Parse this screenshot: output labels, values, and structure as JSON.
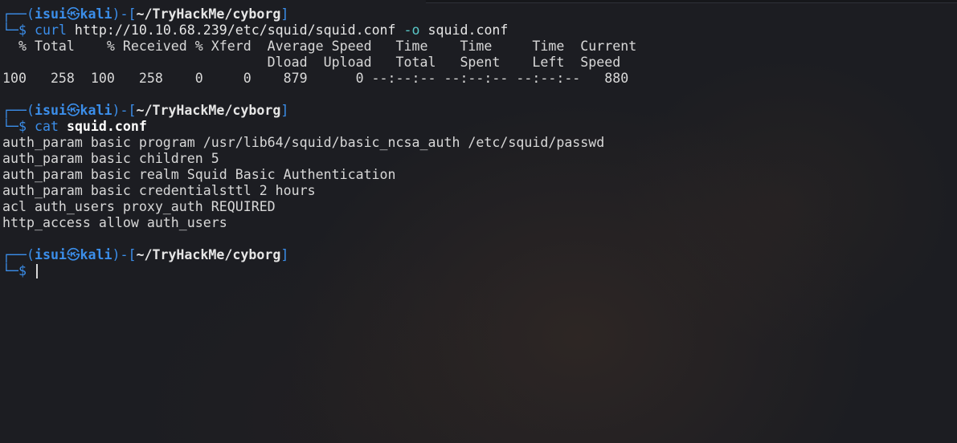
{
  "prompt": {
    "open": "┌──(",
    "user": "isui",
    "at": "㉿",
    "host": "kali",
    "mid": ")-[",
    "path": "~/TryHackMe/cyborg",
    "close": "]",
    "second_line": "└─",
    "dollar": "$ "
  },
  "blocks": [
    {
      "cmd": "curl",
      "args_before": " http://10.10.68.239/etc/squid/squid.conf ",
      "flag": "-o",
      "args_after": " squid.conf",
      "output": [
        "  % Total    % Received % Xferd  Average Speed   Time    Time     Time  Current",
        "                                 Dload  Upload   Total   Spent    Left  Speed",
        "100   258  100   258    0     0    879      0 --:--:-- --:--:-- --:--:--   880"
      ]
    },
    {
      "cmd": "cat",
      "args_before": " ",
      "arg_bold": "squid.conf",
      "output": [
        "auth_param basic program /usr/lib64/squid/basic_ncsa_auth /etc/squid/passwd",
        "auth_param basic children 5",
        "auth_param basic realm Squid Basic Authentication",
        "auth_param basic credentialsttl 2 hours",
        "acl auth_users proxy_auth REQUIRED",
        "http_access allow auth_users"
      ]
    }
  ],
  "colors": {
    "prompt_accent": "#3b8eea",
    "flag": "#5ac8c8",
    "text": "#d8d8d8",
    "background": "#1c1d22"
  }
}
